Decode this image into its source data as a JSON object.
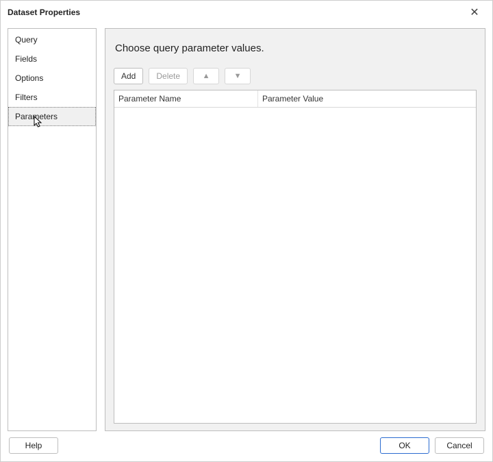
{
  "titlebar": {
    "title": "Dataset Properties",
    "close_label": "✕"
  },
  "sidebar": {
    "items": [
      {
        "label": "Query",
        "selected": false
      },
      {
        "label": "Fields",
        "selected": false
      },
      {
        "label": "Options",
        "selected": false
      },
      {
        "label": "Filters",
        "selected": false
      },
      {
        "label": "Parameters",
        "selected": true
      }
    ]
  },
  "main": {
    "heading": "Choose query parameter values.",
    "toolbar": {
      "add_label": "Add",
      "delete_label": "Delete"
    },
    "grid": {
      "columns": [
        "Parameter Name",
        "Parameter Value"
      ],
      "rows": []
    }
  },
  "footer": {
    "help_label": "Help",
    "ok_label": "OK",
    "cancel_label": "Cancel"
  }
}
